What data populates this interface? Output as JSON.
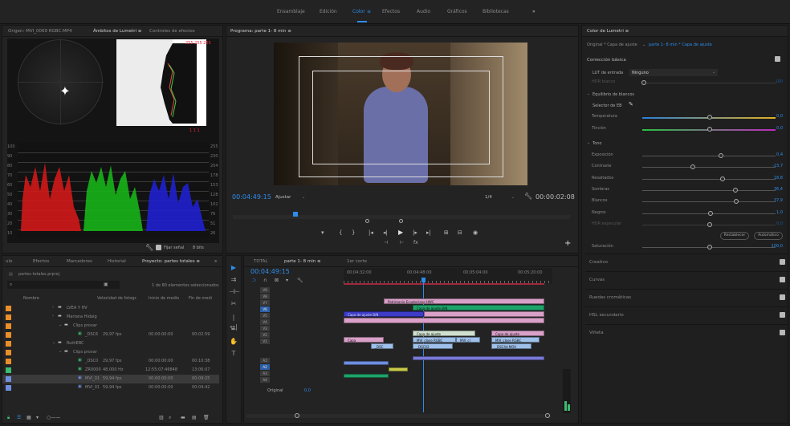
{
  "workspaces": [
    "Ensamblaje",
    "Edición",
    "Color",
    "Efectos",
    "Audio",
    "Gráficos",
    "Bibliotecas"
  ],
  "active_workspace": "Color",
  "workspace_more": "»",
  "source_panel": {
    "tab1": "Origen: MVI_0069 RGBC.MP4",
    "tab2": "Ámbitos de Lumetri ≡",
    "tab3": "Controles de efectos",
    "hist_top_values": "255  255  255",
    "hist_bottom_values": "1  1  1",
    "wave_scale_left": [
      "100",
      "90",
      "80",
      "70",
      "60",
      "50",
      "40",
      "30",
      "20",
      "10"
    ],
    "wave_scale_right": [
      "255",
      "230",
      "204",
      "178",
      "153",
      "128",
      "102",
      "76",
      "51",
      "26"
    ],
    "clamp_label": "Fijar señal",
    "bits": "8 bits"
  },
  "program": {
    "tab": "Programa: parte 1- 8 min ≡",
    "timecode": "00:04:49:15",
    "fit": "Ajustar",
    "quality": "1/4",
    "duration": "00:00:02:08"
  },
  "lumetri": {
    "tab": "Color de Lumetri ≡",
    "path_left": "Original * Capa de ajuste",
    "path_right": "parte 1- 8 min * Capa de ajuste",
    "section_basic": "Corrección básica",
    "lut_label": "LUT de entrada",
    "lut_value": "Ninguno",
    "hdr_label": "HDR blanco",
    "hdr_value": "100",
    "wb_label": "Equilibrio de blancos",
    "wb_selector": "Selector de EB",
    "temp_label": "Temperatura",
    "temp_value": "0,0",
    "tint_label": "Tinción",
    "tint_value": "0,0",
    "tone_label": "Tono",
    "exposure_label": "Exposición",
    "exposure_value": "0,4",
    "contrast_label": "Contraste",
    "contrast_value": "-23,7",
    "highlights_label": "Resaltados",
    "highlights_value": "18,8",
    "shadows_label": "Sombras",
    "shadows_value": "36,4",
    "whites_label": "Blancos",
    "whites_value": "37,9",
    "blacks_label": "Negros",
    "blacks_value": "1,0",
    "hdr_spec_label": "HDR especular",
    "hdr_spec_value": "0,0",
    "reset_button": "Restablecer",
    "auto_button": "Automático",
    "saturation_label": "Saturación",
    "saturation_value": "100,0",
    "sections": [
      "Creativo",
      "Curvas",
      "Ruedas cromáticas",
      "HSL secundario",
      "Viñeta"
    ]
  },
  "project": {
    "tabs": [
      "ulo",
      "Efectos",
      "Marcadores",
      "Historial",
      "Proyecto: partes totales ≡"
    ],
    "more": "»",
    "file": "partes totales.prproj",
    "count": "1 de 80 elementos seleccionados",
    "col_name": "Nombre",
    "col_fps": "Velocidad de fotogr.",
    "col_in": "Inicio de medio",
    "col_end": "Fin de medi",
    "rows": [
      {
        "name": "LVEA Y HV",
        "fps": "",
        "in": "",
        "end": "",
        "color": "#e98e2a"
      },
      {
        "name": "Mariana Hidalg",
        "fps": "",
        "in": "",
        "end": "",
        "color": "#e98e2a"
      },
      {
        "name": "Clips provar",
        "fps": "",
        "in": "",
        "end": "",
        "color": "#e98e2a"
      },
      {
        "name": "_DSC6",
        "fps": "29,97 fps",
        "in": "00:00:00:00",
        "end": "00:02:59",
        "color": "#e98e2a"
      },
      {
        "name": "RuthEBC",
        "fps": "",
        "in": "",
        "end": "",
        "color": "#e98e2a"
      },
      {
        "name": "Clips provar",
        "fps": "",
        "in": "",
        "end": "",
        "color": "#e98e2a"
      },
      {
        "name": "_DSC0",
        "fps": "29,97 fps",
        "in": "00:00:00:00",
        "end": "00:10:38",
        "color": "#e98e2a"
      },
      {
        "name": "ZR0000",
        "fps": "48.000 Hz",
        "in": "12:55:07:46848",
        "end": "13:06:07",
        "color": "#3dbb6e"
      },
      {
        "name": "MVI_01",
        "fps": "59,94 fps",
        "in": "00:00:00:00",
        "end": "00:09:25",
        "color": "#6e8fe0"
      },
      {
        "name": "MVI_01",
        "fps": "59,94 fps",
        "in": "00:00:00:00",
        "end": "00:04:42",
        "color": "#6e8fe0"
      }
    ]
  },
  "timeline": {
    "tab_total": "TOTAL",
    "tab_seq": "parte 1- 8 min ≡",
    "tab_other": "1er corte",
    "timecode": "00:04:49:15",
    "ruler": [
      "00:04:32:00",
      "00:04:48:00",
      "00:05:04:00",
      "00:05:20:00"
    ],
    "video_tracks": [
      "V9",
      "V8",
      "V7",
      "V6",
      "V5",
      "V4",
      "V3",
      "V2",
      "V1"
    ],
    "audio_tracks": [
      "A1",
      "A2",
      "A3",
      "A4"
    ],
    "original_label": "Original",
    "original_value": "0,0",
    "clips": {
      "patrimonio": "Patrimonio Ecuatoriano HWC",
      "capa_ajuste": "Capa de ajuste",
      "capa_bn": "Capa de ajuste B/N",
      "mvi": "MVI_close RGBC",
      "mvi2": "MVI_cl",
      "dsc": "_DSC",
      "dsc2": "_DSC02",
      "dsc3": "_DSC4d.MOV",
      "capa_short": "Capa"
    }
  }
}
